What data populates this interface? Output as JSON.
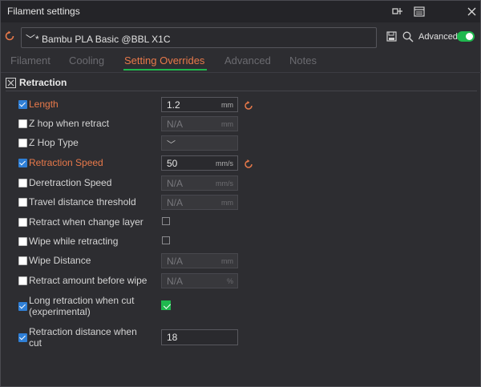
{
  "window": {
    "title": "Filament settings"
  },
  "preset": {
    "name": "Bambu PLA Basic @BBL X1C",
    "prefix": "﹀* "
  },
  "advanced": {
    "label": "Advanced",
    "on": true
  },
  "tabs": [
    {
      "label": "Filament"
    },
    {
      "label": "Cooling"
    },
    {
      "label": "Setting Overrides",
      "active": true
    },
    {
      "label": "Advanced"
    },
    {
      "label": "Notes"
    }
  ],
  "section": {
    "title": "Retraction"
  },
  "rows": {
    "length": {
      "label": "Length",
      "value": "1.2",
      "unit": "mm"
    },
    "z_hop": {
      "label": "Z hop when retract",
      "value": "N/A",
      "unit": "mm"
    },
    "z_hop_type": {
      "label": "Z Hop Type",
      "value": "﹀"
    },
    "retraction_speed": {
      "label": "Retraction Speed",
      "value": "50",
      "unit": "mm/s"
    },
    "deretraction_speed": {
      "label": "Deretraction Speed",
      "value": "N/A",
      "unit": "mm/s"
    },
    "travel_threshold": {
      "label": "Travel distance threshold",
      "value": "N/A",
      "unit": "mm"
    },
    "retract_layer": {
      "label": "Retract when change layer"
    },
    "wipe_retract": {
      "label": "Wipe while retracting"
    },
    "wipe_distance": {
      "label": "Wipe Distance",
      "value": "N/A",
      "unit": "mm"
    },
    "retract_before_wipe": {
      "label": "Retract amount before wipe",
      "value": "N/A",
      "unit": "%"
    },
    "long_retraction": {
      "label_line1": "Long retraction when cut",
      "label_line2": "(experimental)"
    },
    "retraction_distance_cut": {
      "label_line1": "Retraction distance when",
      "label_line2": "cut",
      "value": "18"
    }
  },
  "colors": {
    "accent": "#e8794a",
    "green": "#1fb84e",
    "check_blue": "#2f7fd6"
  }
}
